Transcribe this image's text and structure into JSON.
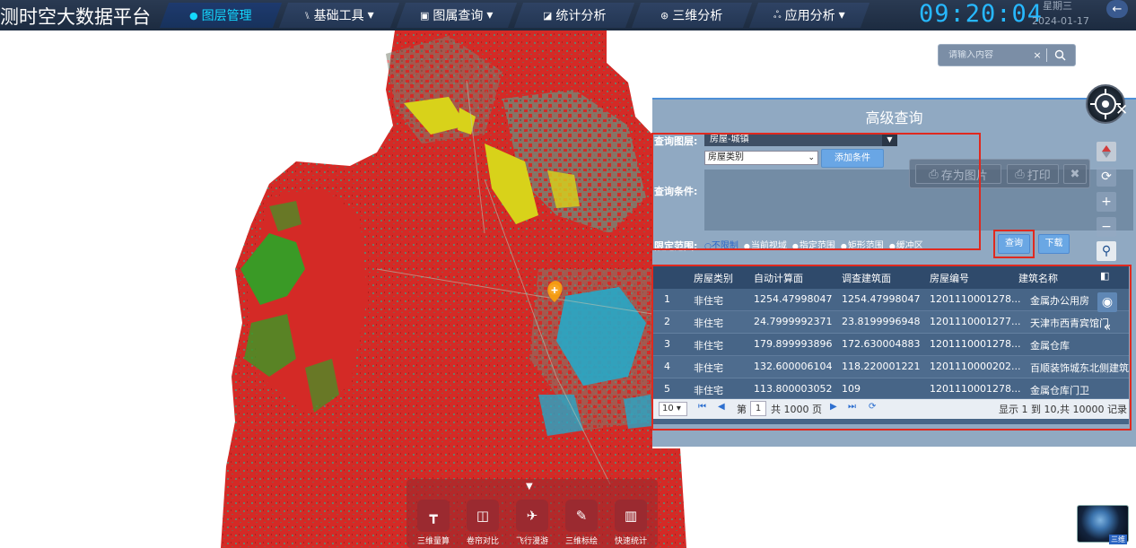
{
  "header": {
    "app_title": "测时空大数据平台",
    "nav": [
      {
        "label": "图层管理",
        "glyph": "●",
        "active": true
      },
      {
        "label": "基础工具",
        "glyph": "⑊",
        "dropdown": true
      },
      {
        "label": "图属查询",
        "glyph": "▣",
        "dropdown": true
      },
      {
        "label": "统计分析",
        "glyph": "◪"
      },
      {
        "label": "三维分析",
        "glyph": "⊛"
      },
      {
        "label": "应用分析",
        "glyph": "ஃ",
        "dropdown": true
      }
    ],
    "clock": "09:20:04",
    "weekday": "星期三",
    "date": "2024-01-17",
    "back_icon": "←"
  },
  "search": {
    "placeholder": "请输入内容",
    "clear_glyph": "×"
  },
  "query_panel": {
    "title": "高级查询",
    "layer_label": "查询图层:",
    "layer_value": "房屋-城镇",
    "field_value": "房屋类别",
    "add_condition": "添加条件",
    "condition_label": "查询条件:",
    "range_label": "限定范围:",
    "range_options": [
      "不限制",
      "当前视域",
      "指定范围",
      "矩形范围",
      "缓冲区"
    ],
    "query_button": "查询",
    "download_button": "下载",
    "save_image": "存为图片",
    "print": "打印",
    "close": "✖"
  },
  "table": {
    "columns": [
      "房屋类别",
      "自动计算面",
      "调查建筑面",
      "房屋编号",
      "建筑名称"
    ],
    "rows": [
      {
        "no": "1",
        "cat": "非住宅",
        "auto": "1254.47998047",
        "survey": "1254.47998047",
        "code": "1201110001278...",
        "name": "金属办公用房"
      },
      {
        "no": "2",
        "cat": "非住宅",
        "auto": "24.7999992371",
        "survey": "23.8199996948",
        "code": "1201110001277...",
        "name": "天津市西青宾馆门卫"
      },
      {
        "no": "3",
        "cat": "非住宅",
        "auto": "179.899993896",
        "survey": "172.630004883",
        "code": "1201110001278...",
        "name": "金属仓库"
      },
      {
        "no": "4",
        "cat": "非住宅",
        "auto": "132.600006104",
        "survey": "118.220001221",
        "code": "1201110000202...",
        "name": "百顺装饰城东北侧建筑"
      },
      {
        "no": "5",
        "cat": "非住宅",
        "auto": "113.800003052",
        "survey": "109",
        "code": "1201110001278...",
        "name": "金属仓库门卫"
      }
    ],
    "page_size": "10",
    "page_prefix": "第",
    "page_current": "1",
    "page_suffix": "共 1000 页",
    "summary": "显示 1 到 10,共 10000 记录"
  },
  "bottom_tools": [
    {
      "label": "三维量算",
      "glyph": "┳"
    },
    {
      "label": "卷帘对比",
      "glyph": "◫"
    },
    {
      "label": "飞行漫游",
      "glyph": "✈"
    },
    {
      "label": "三维标绘",
      "glyph": "✎"
    },
    {
      "label": "快速统计",
      "glyph": "▥"
    }
  ],
  "globe_label": "三维",
  "colors": {
    "accent": "#14d9ff",
    "clock": "#27b8ff",
    "highlight": "#e0291f",
    "map_red": "#d42a26",
    "panel": "#7896b4"
  }
}
